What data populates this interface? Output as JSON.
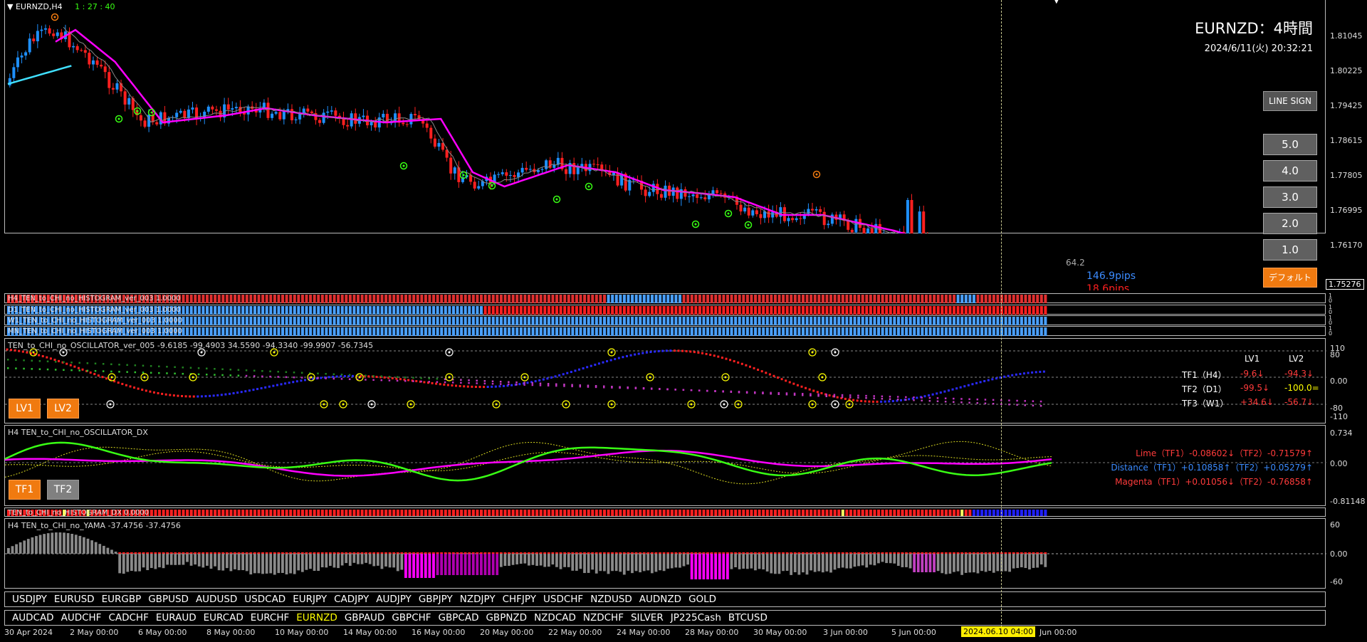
{
  "header": {
    "symbol_tf": "EURNZD,H4",
    "countdown": "1 : 27 : 40"
  },
  "overlay": {
    "title": "EURNZD：4時間",
    "datetime": "2024/6/11(火) 20:32:21"
  },
  "buttons": {
    "line_sign": "LINE SIGN",
    "levels": [
      "5.0",
      "4.0",
      "3.0",
      "2.0",
      "1.0"
    ],
    "default": "デフォルト",
    "lv1": "LV1",
    "lv2": "LV2",
    "tf1": "TF1",
    "tf2": "TF2"
  },
  "price_axis": [
    "1.81045",
    "1.80225",
    "1.79425",
    "1.78615",
    "1.77805",
    "1.76995",
    "1.76170"
  ],
  "current_price": "1.75276",
  "chart_labels": {
    "value": "64.2",
    "pips_up": "146.9pips",
    "pips_down": "18.6pips"
  },
  "histogram_titles": [
    "H4_TEN_to_CHI_no_HISTOGRAM_ver_003 1.0000",
    "D1_TEN_to_CHI_no_HISTOGRAM_ver_003 1.0000",
    "W1_TEN_to_CHI_no_HISTOGRAM_ver_003 1.0000",
    "MN_TEN_to_CHI_no_HISTOGRAM_ver_003 1.0000"
  ],
  "oscillator": {
    "title": "TEN_to_CHI_no_OSCILLATOR_ver_005 -9.6185 -99.4903 34.5590 -94.3340 -99.9907 -56.7345",
    "axis": [
      "110",
      "80",
      "0.00",
      "-80",
      "-110"
    ],
    "headers": [
      "LV1",
      "LV2"
    ],
    "rows": [
      {
        "label": "TF1（H4）",
        "lv1": "-9.6↓",
        "lv2": "-94.3↓",
        "c1": "#ff3b3b",
        "c2": "#ff3b3b"
      },
      {
        "label": "TF2（D1）",
        "lv1": "-99.5↓",
        "lv2": "-100.0=",
        "c1": "#ff3b3b",
        "c2": "#ffff00"
      },
      {
        "label": "TF3（W1）",
        "lv1": "+34.6↓",
        "lv2": "-56.7↓",
        "c1": "#ff3b3b",
        "c2": "#ff3b3b"
      }
    ]
  },
  "dx": {
    "title": "H4 TEN_to_CHI_no_OSCILLATOR_DX",
    "axis": [
      "0.734",
      "0.00",
      "-0.81148"
    ],
    "lines": [
      {
        "text": "Lime（TF1）-0.08602↓（TF2）-0.71579↑",
        "color": "#ff3b3b"
      },
      {
        "text": "Distance（TF1）+0.10858↑（TF2）+0.05279↑",
        "color": "#3b8bff"
      },
      {
        "text": "Magenta（TF1）+0.01056↓（TF2）-0.76858↑",
        "color": "#ff3b3b"
      }
    ]
  },
  "dx_histogram_title": "TEN_to_CHI_no_HISTOGRAM_DX 0.0000",
  "yama": {
    "title": "H4  TEN_to_CHI_no_YAMA -37.4756 -37.4756",
    "axis": [
      "60",
      "0.00",
      "-60"
    ]
  },
  "symbols_row1": [
    "USDJPY",
    "EURUSD",
    "EURGBP",
    "GBPUSD",
    "AUDUSD",
    "USDCAD",
    "EURJPY",
    "CADJPY",
    "AUDJPY",
    "GBPJPY",
    "NZDJPY",
    "CHFJPY",
    "USDCHF",
    "NZDUSD",
    "AUDNZD",
    "GOLD"
  ],
  "symbols_row2": [
    "AUDCAD",
    "AUDCHF",
    "CADCHF",
    "EURAUD",
    "EURCAD",
    "EURCHF",
    "EURNZD",
    "GBPAUD",
    "GBPCHF",
    "GBPCAD",
    "GBPNZD",
    "NZDCAD",
    "NZDCHF",
    "SILVER",
    "JP225Cash",
    "BTCUSD"
  ],
  "active_symbol": "EURNZD",
  "time_axis": [
    "30 Apr 2024",
    "2 May 00:00",
    "6 May 00:00",
    "8 May 00:00",
    "10 May 00:00",
    "14 May 00:00",
    "16 May 00:00",
    "20 May 00:00",
    "22 May 00:00",
    "24 May 00:00",
    "28 May 00:00",
    "30 May 00:00",
    "3 Jun 00:00",
    "5 Jun 00:00",
    "Jun 00:00"
  ],
  "crosshair_time": "2024.06.10 04:00",
  "colors": {
    "bull": "#1e90ff",
    "bear": "#ff2020",
    "ma": "#ff00ff",
    "cyan": "#40e0ff",
    "lime": "#39ff14",
    "orange": "#f07a10"
  }
}
